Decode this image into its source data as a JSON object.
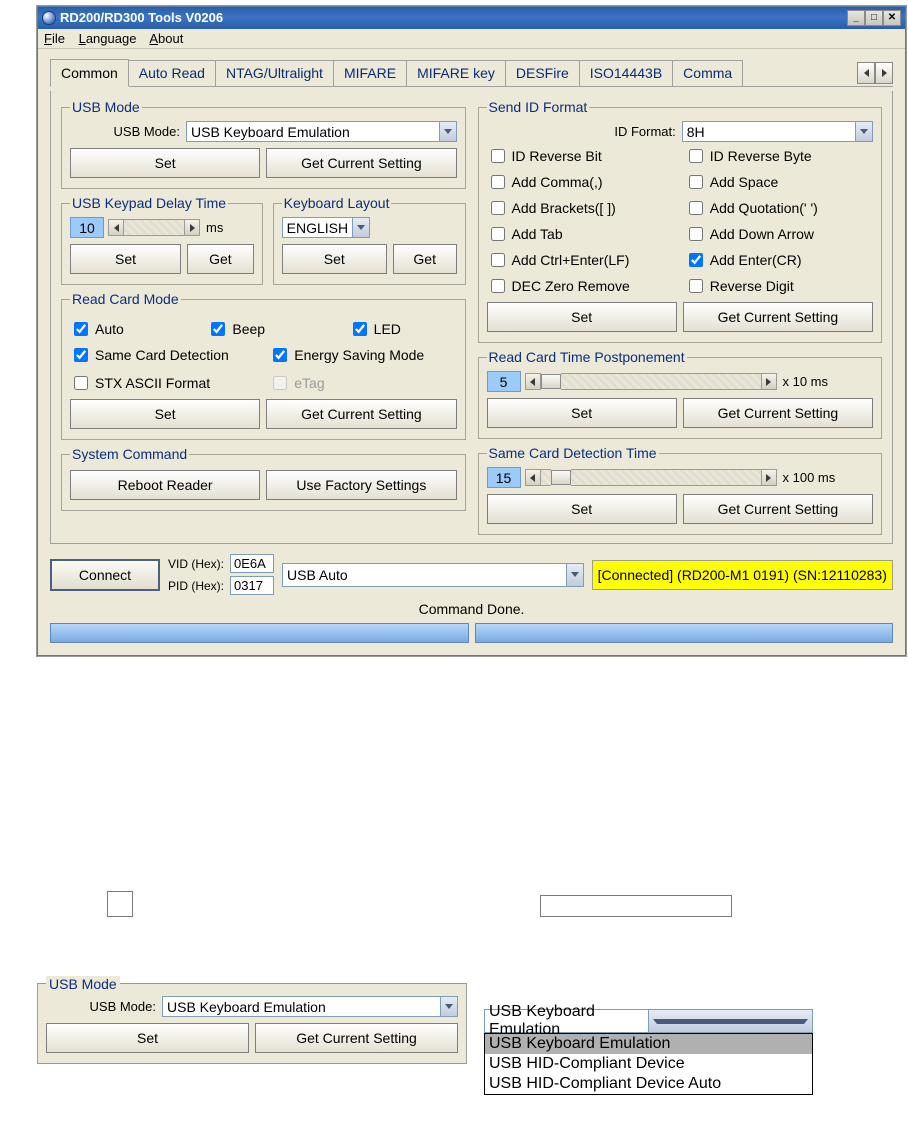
{
  "title": "RD200/RD300 Tools V0206",
  "menu": {
    "file": "File",
    "language": "Language",
    "about": "About"
  },
  "tabs": [
    "Common",
    "Auto Read",
    "NTAG/Ultralight",
    "MIFARE",
    "MIFARE key",
    "DESFire",
    "ISO14443B",
    "Comma"
  ],
  "usbmode": {
    "legend": "USB Mode",
    "label": "USB Mode:",
    "value": "USB Keyboard Emulation",
    "set": "Set",
    "get": "Get Current Setting"
  },
  "keypad": {
    "legend": "USB Keypad Delay Time",
    "value": "10",
    "unit": "ms",
    "set": "Set",
    "get": "Get"
  },
  "kblayout": {
    "legend": "Keyboard Layout",
    "value": "ENGLISH",
    "set": "Set",
    "get": "Get"
  },
  "readcard": {
    "legend": "Read Card Mode",
    "auto": "Auto",
    "beep": "Beep",
    "led": "LED",
    "same": "Same Card Detection",
    "energy": "Energy Saving Mode",
    "stx": "STX ASCII Format",
    "etag": "eTag",
    "set": "Set",
    "get": "Get Current Setting"
  },
  "syscmd": {
    "legend": "System Command",
    "reboot": "Reboot Reader",
    "factory": "Use Factory Settings"
  },
  "sendid": {
    "legend": "Send ID Format",
    "label": "ID Format:",
    "value": "8H",
    "revbit": "ID Reverse Bit",
    "revbyte": "ID Reverse Byte",
    "comma": "Add Comma(,)",
    "space": "Add Space",
    "brackets": "Add Brackets([ ])",
    "quote": "Add Quotation(' ')",
    "tab": "Add Tab",
    "down": "Add Down Arrow",
    "ctrlenter": "Add Ctrl+Enter(LF)",
    "addenter": "Add Enter(CR)",
    "deczero": "DEC Zero Remove",
    "revdigit": "Reverse Digit",
    "set": "Set",
    "get": "Get Current Setting"
  },
  "postpone": {
    "legend": "Read Card Time Postponement",
    "value": "5",
    "unit": "x 10 ms",
    "set": "Set",
    "get": "Get Current Setting"
  },
  "samecard": {
    "legend": "Same Card Detection Time",
    "value": "15",
    "unit": "x 100 ms",
    "set": "Set",
    "get": "Get Current Setting"
  },
  "connect": {
    "btn": "Connect",
    "vidlbl": "VID (Hex):",
    "pidlbl": "PID (Hex):",
    "vid": "0E6A",
    "pid": "0317",
    "usb": "USB Auto",
    "status": "[Connected] (RD200-M1    0191) (SN:12110283)"
  },
  "cmd_done": "Command Done.",
  "snippet_usbmode": {
    "legend": "USB Mode",
    "label": "USB Mode:",
    "value": "USB Keyboard Emulation",
    "set": "Set",
    "get": "Get Current Setting"
  },
  "snippet_dd": {
    "selected": "USB Keyboard Emulation",
    "items": [
      "USB Keyboard Emulation",
      "USB HID-Compliant Device",
      "USB HID-Compliant Device Auto"
    ]
  }
}
